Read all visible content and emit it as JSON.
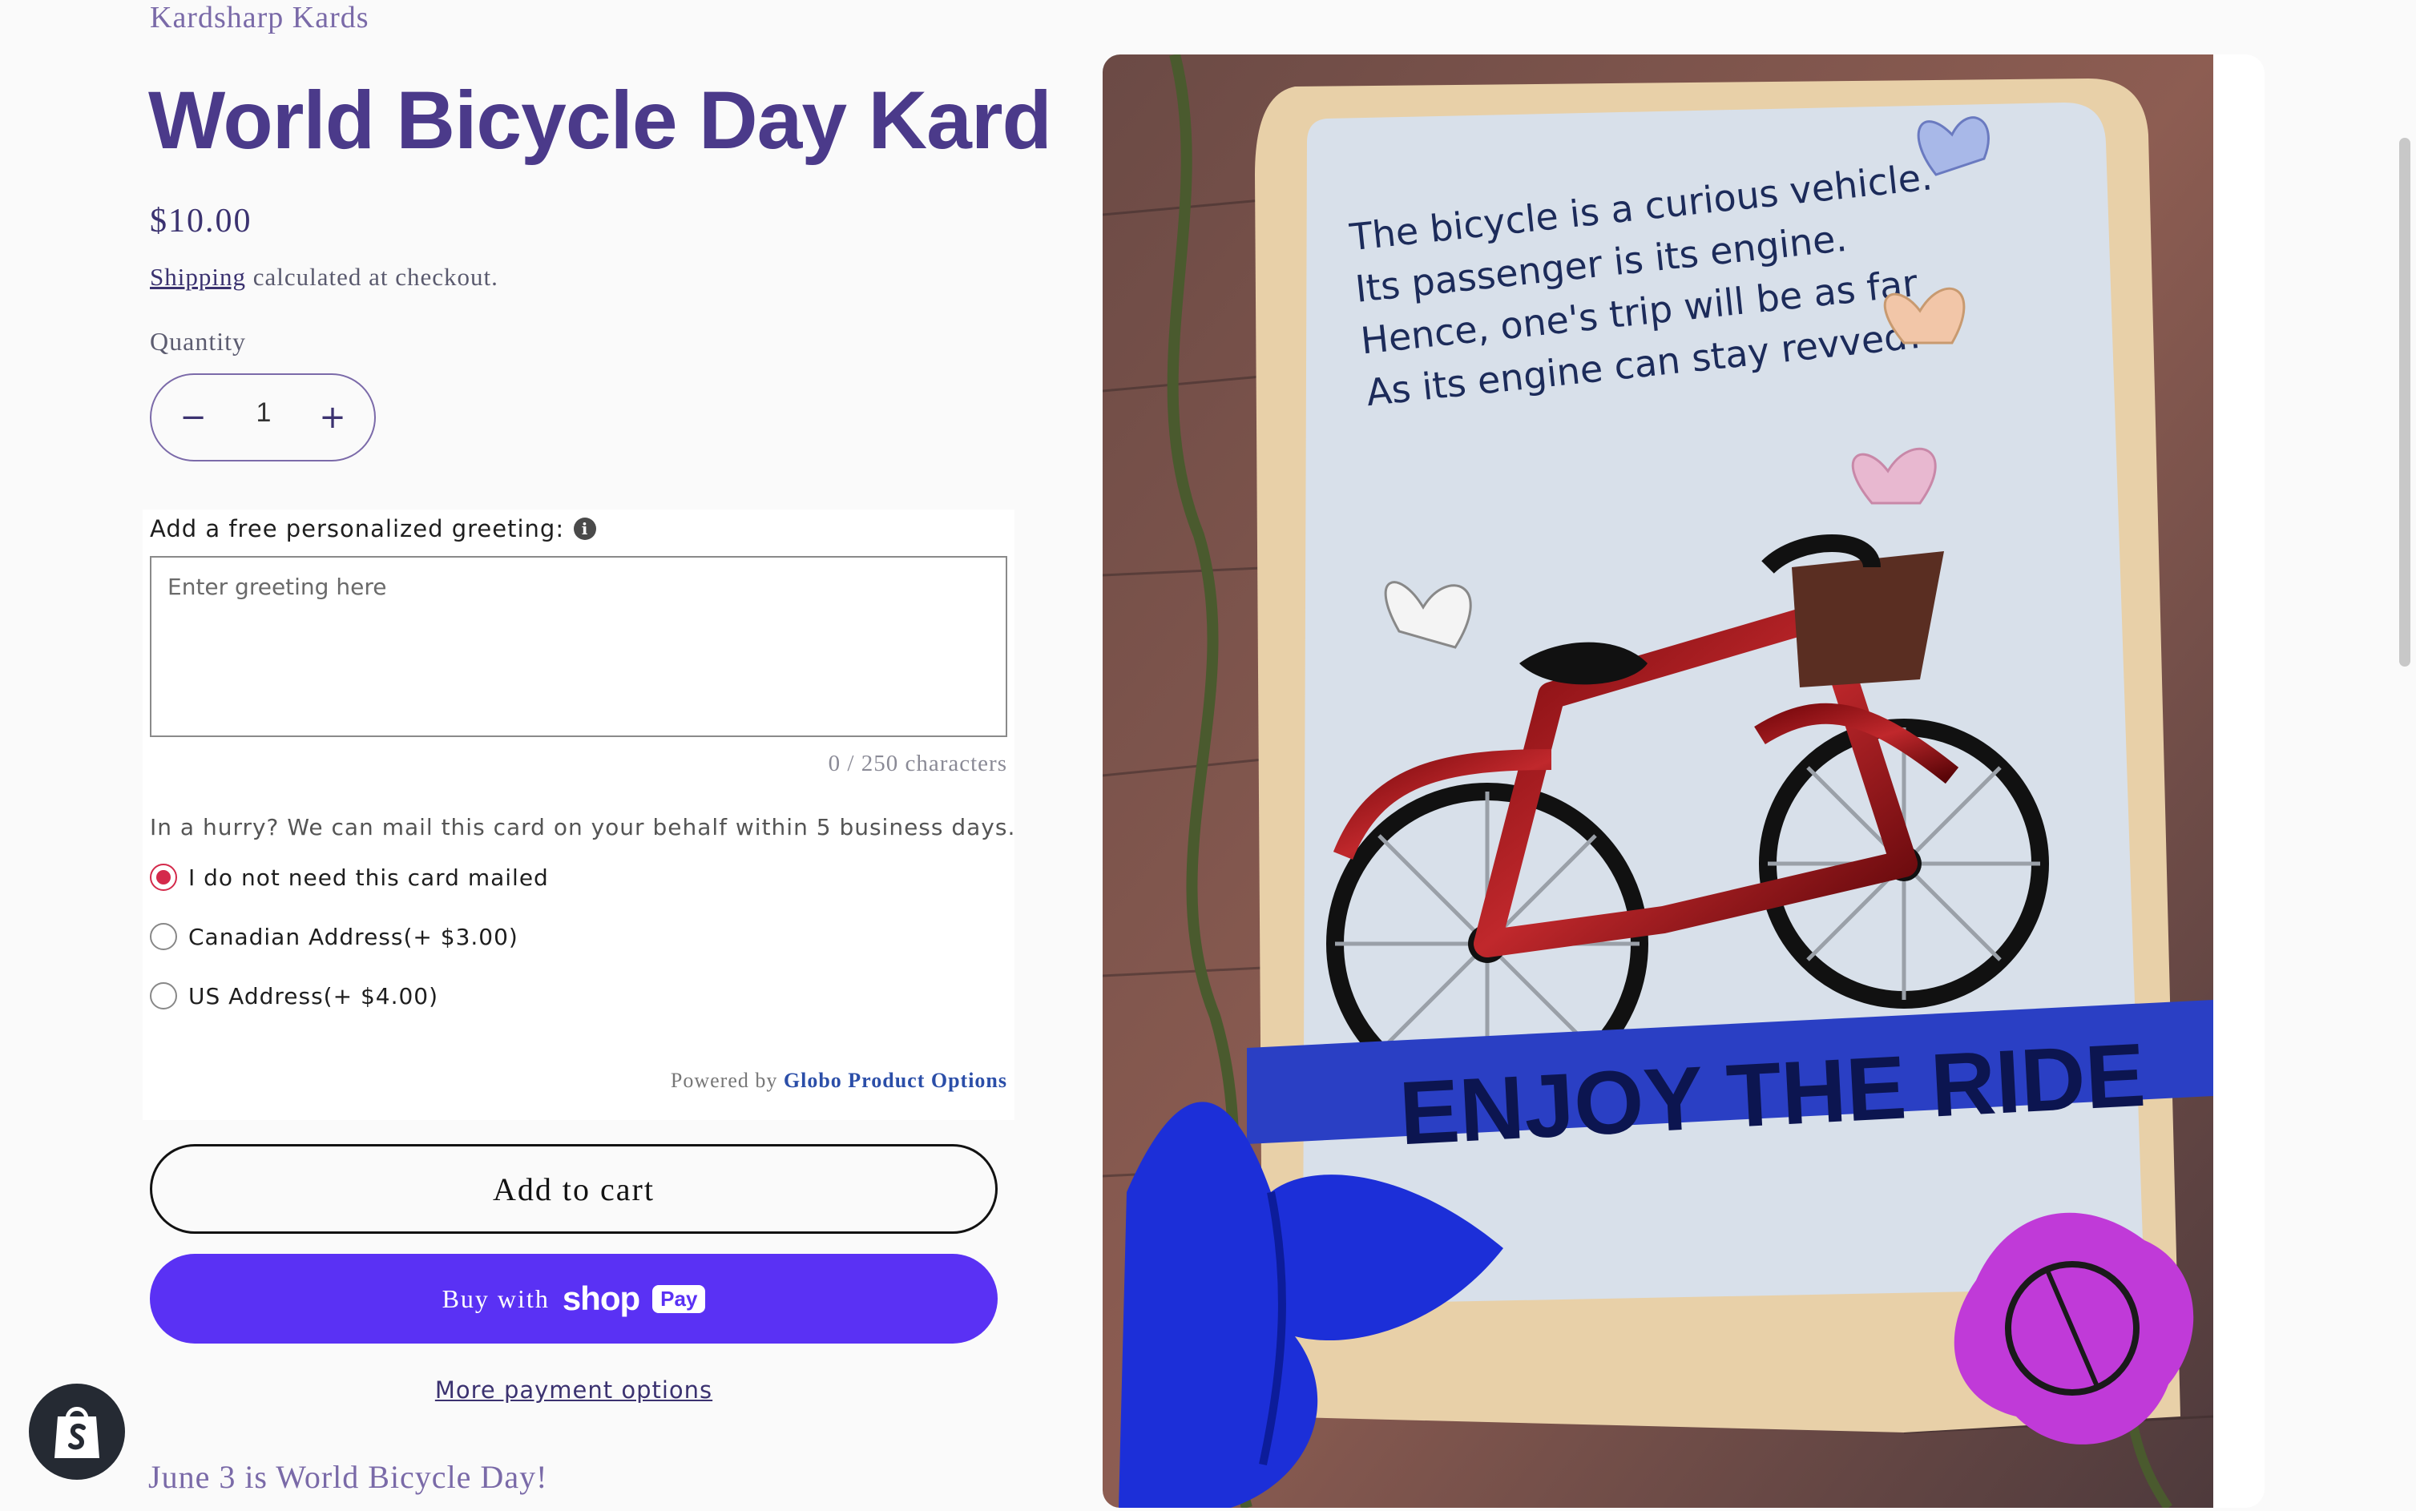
{
  "product": {
    "vendor": "Kardsharp Kards",
    "title": "World Bicycle Day Kard",
    "price": "$10.00",
    "shipping_link": "Shipping",
    "shipping_text": " calculated at checkout.",
    "quantity_label": "Quantity",
    "quantity_value": "1",
    "description": "June 3 is World Bicycle Day!"
  },
  "options": {
    "greeting_label": "Add a free personalized greeting:",
    "greeting_placeholder": "Enter greeting here",
    "counter": "0 / 250 characters",
    "hurry_text": "In a hurry? We can mail this card on your behalf within 5 business days.",
    "mail_options": [
      {
        "label": "I do not need this card mailed",
        "checked": true
      },
      {
        "label": "Canadian Address(+ $3.00)",
        "checked": false
      },
      {
        "label": "US Address(+ $4.00)",
        "checked": false
      }
    ],
    "powered_prefix": "Powered by ",
    "powered_brand": "Globo Product Options"
  },
  "buttons": {
    "add_to_cart": "Add to cart",
    "buy_with": "Buy with",
    "shop_word": "shop",
    "pay_word": "Pay",
    "more_payment": "More payment options"
  },
  "image": {
    "card_poem": [
      "The bicycle is a curious vehicle.",
      "Its passenger is its engine.",
      "Hence, one's trip will be as far",
      "As its engine can stay revved!"
    ],
    "banner": "ENJOY THE RIDE"
  },
  "colors": {
    "accent": "#4b3a8a",
    "shop_pay": "#5a31f4",
    "radio_selected": "#d42a4b"
  }
}
